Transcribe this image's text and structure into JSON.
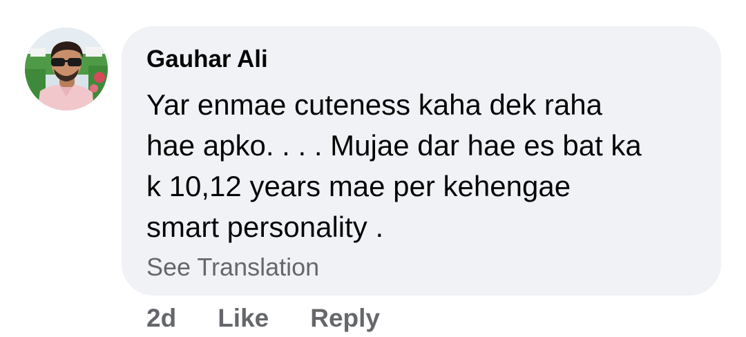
{
  "comment": {
    "author": "Gauhar Ali",
    "text_lines": [
      "Yar enmae cuteness kaha dek raha",
      "hae apko. . . . Mujae dar hae es bat ka",
      "k 10,12 years mae per kehengae",
      "smart personality ."
    ],
    "see_translation": "See Translation",
    "timestamp": "2d",
    "like_label": "Like",
    "reply_label": "Reply"
  },
  "avatar": {
    "icon": "profile-photo",
    "description_colors": {
      "sky": "#d9e3ea",
      "foliage": "#3f8a3a",
      "shirt": "#f2c7cc",
      "skin": "#c98f6b",
      "hair": "#2b1d16",
      "glasses": "#1b1b1b"
    }
  },
  "colors": {
    "bubble_bg": "#f0f2f5",
    "primary_text": "#050505",
    "secondary_text": "#65676b",
    "page_bg": "#ffffff"
  }
}
